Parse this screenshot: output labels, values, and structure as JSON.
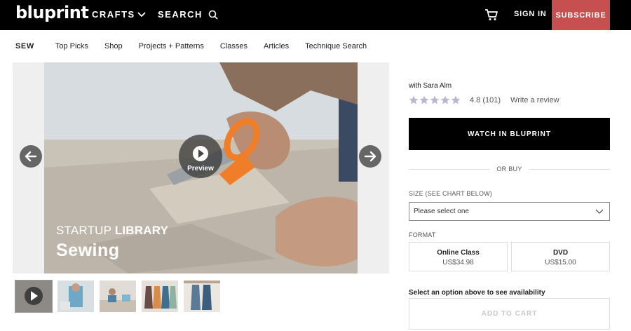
{
  "header": {
    "logo": "bluprint",
    "crafts_label": "CRAFTS",
    "search_label": "SEARCH",
    "signin_label": "SIGN IN",
    "subscribe_label": "SUBSCRIBE",
    "subscribe_color": "#c5504f"
  },
  "subnav": {
    "section": "SEW",
    "items": [
      "Top Picks",
      "Shop",
      "Projects + Patterns",
      "Classes",
      "Articles",
      "Technique Search"
    ]
  },
  "hero": {
    "overline_light": "STARTUP ",
    "overline_bold": "LIBRARY",
    "title": "Sewing",
    "play_label": "Preview"
  },
  "product": {
    "instructor": "with Sara Alm",
    "rating_value": "4.8 (101)",
    "rating_stars": 4.8,
    "write_review": "Write a review",
    "watch_label": "WATCH IN BLUPRINT",
    "or_buy": "OR BUY",
    "size_label": "SIZE (SEE CHART BELOW)",
    "size_selected": "Please select one",
    "format_label": "FORMAT",
    "formats": [
      {
        "name": "Online Class",
        "price": "US$34.98"
      },
      {
        "name": "DVD",
        "price": "US$15.00"
      }
    ],
    "availability_note": "Select an option above to see availability",
    "add_to_cart": "ADD TO CART"
  },
  "icons": {
    "cart": "cart-icon",
    "search": "search-icon",
    "chevron": "chevron-down-icon",
    "play": "play-icon",
    "prev": "arrow-left-icon",
    "next": "arrow-right-icon"
  }
}
